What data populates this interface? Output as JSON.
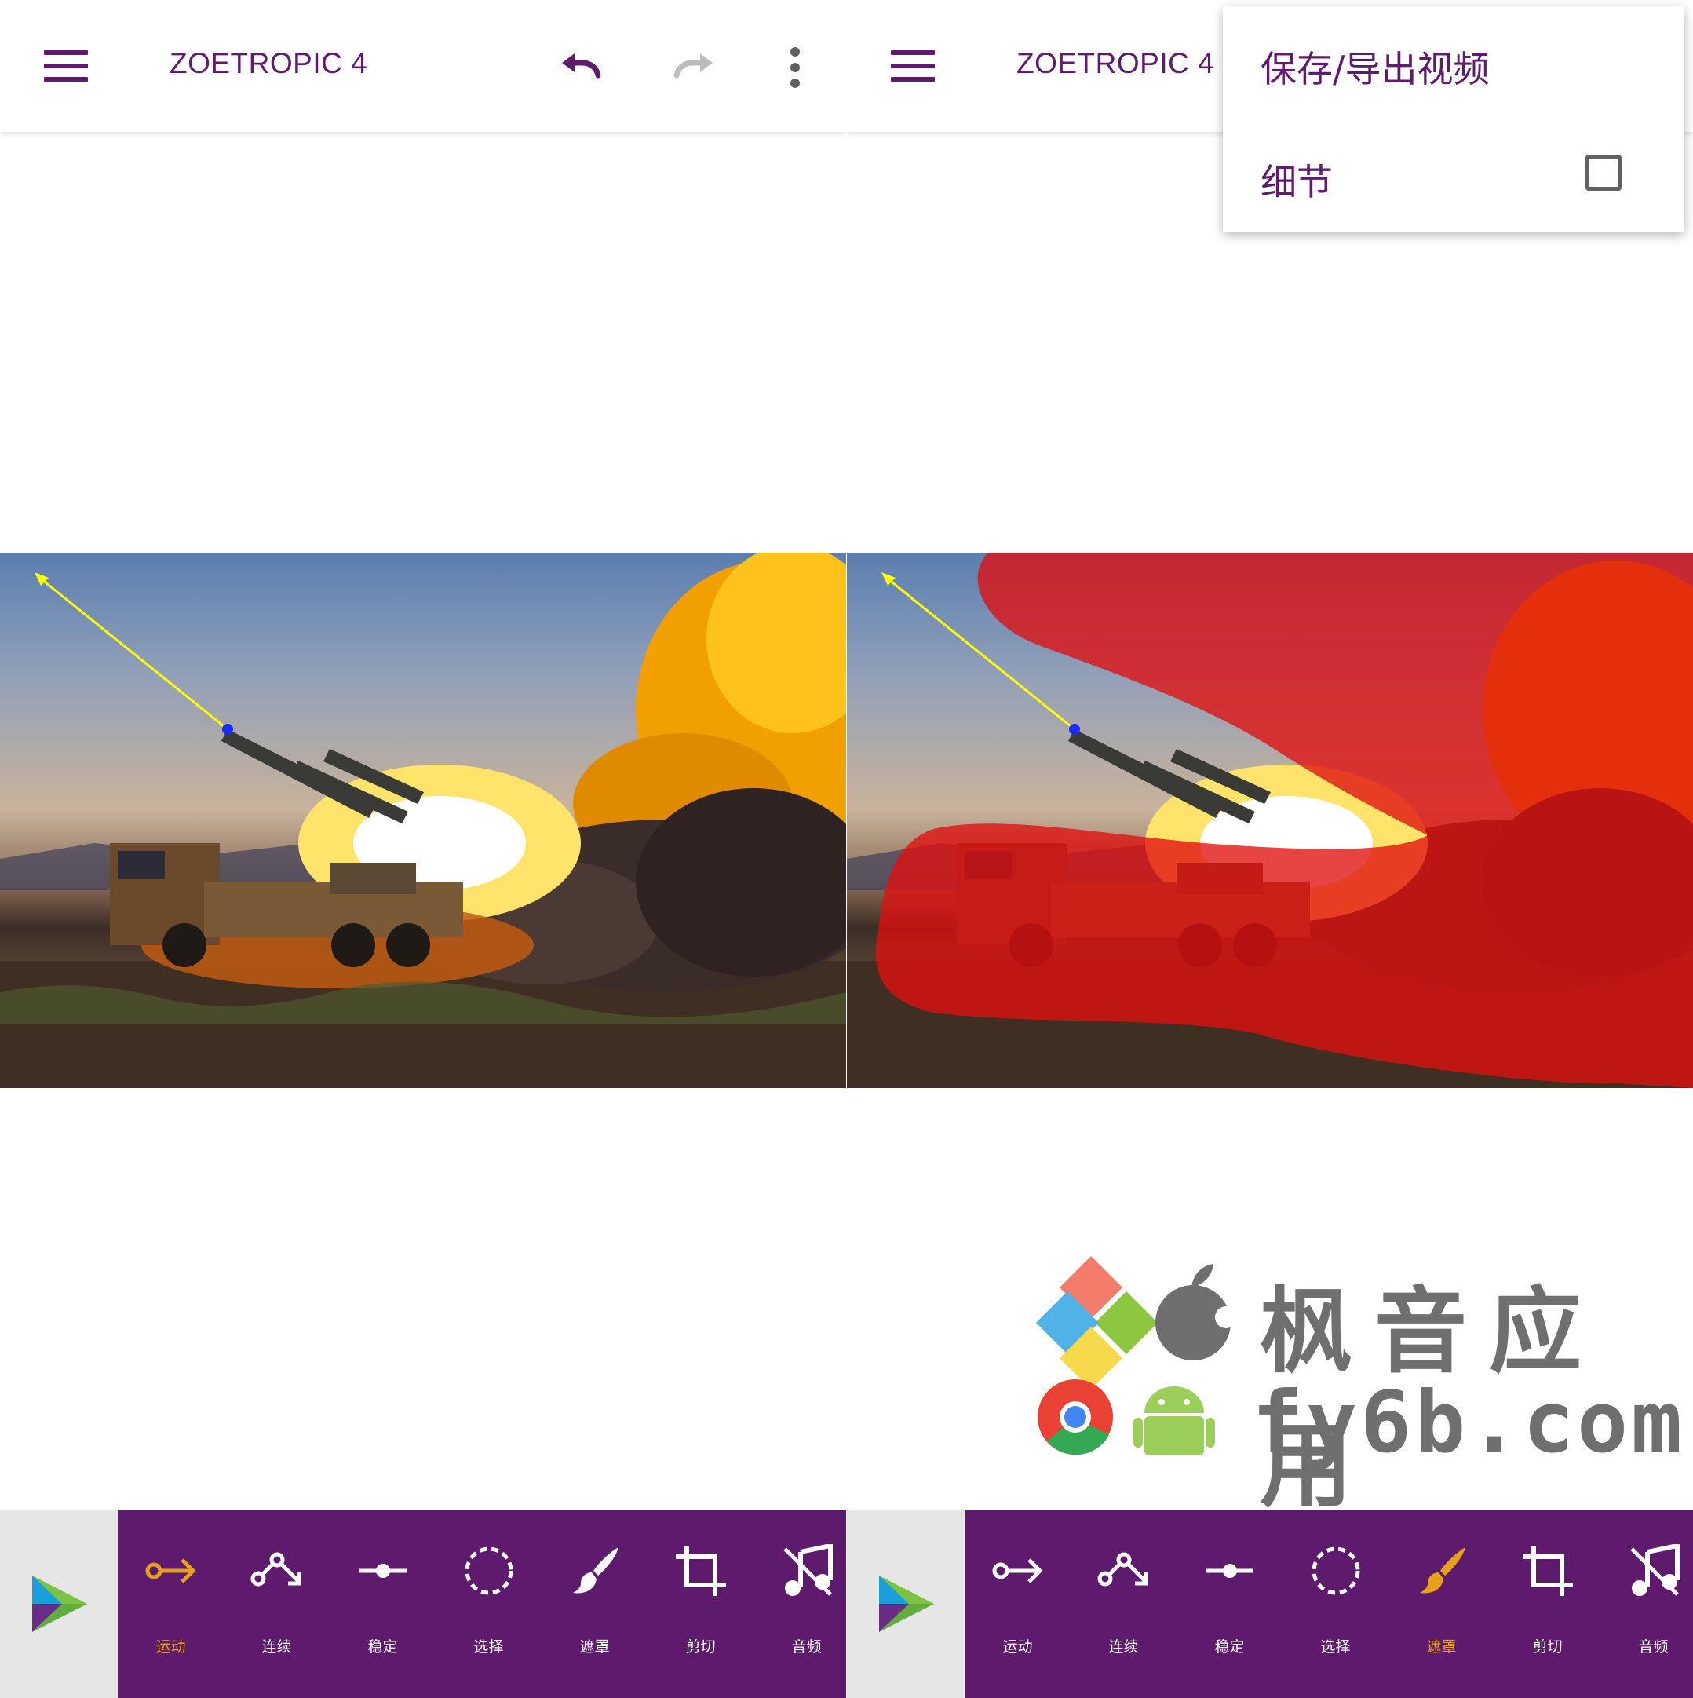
{
  "app": {
    "title": "ZOETROPIC 4",
    "accent_color": "#5f1c6f",
    "active_tool_color": "#e6a11a",
    "toolbar_bg": "#5e1a6c"
  },
  "icons": {
    "menu": "hamburger-menu-icon",
    "undo": "undo-icon",
    "redo": "redo-icon",
    "more": "more-vert-icon",
    "play": "play-icon"
  },
  "left_screen": {
    "active_tool": "运动"
  },
  "right_screen": {
    "active_tool": "遮罩",
    "overflow_menu": {
      "items": [
        {
          "label": "保存/导出视频"
        },
        {
          "label": "细节",
          "checkbox": true,
          "checked": false
        }
      ]
    }
  },
  "tools": [
    {
      "label": "运动",
      "icon": "motion-arrow-icon"
    },
    {
      "label": "连续",
      "icon": "sequence-path-icon"
    },
    {
      "label": "稳定",
      "icon": "anchor-point-icon"
    },
    {
      "label": "选择",
      "icon": "dashed-circle-select-icon"
    },
    {
      "label": "遮罩",
      "icon": "brush-mask-icon"
    },
    {
      "label": "剪切",
      "icon": "crop-icon"
    },
    {
      "label": "音频",
      "icon": "music-off-icon"
    }
  ],
  "watermark": {
    "line1": "枫音应用",
    "line2": "fy6b.com"
  }
}
